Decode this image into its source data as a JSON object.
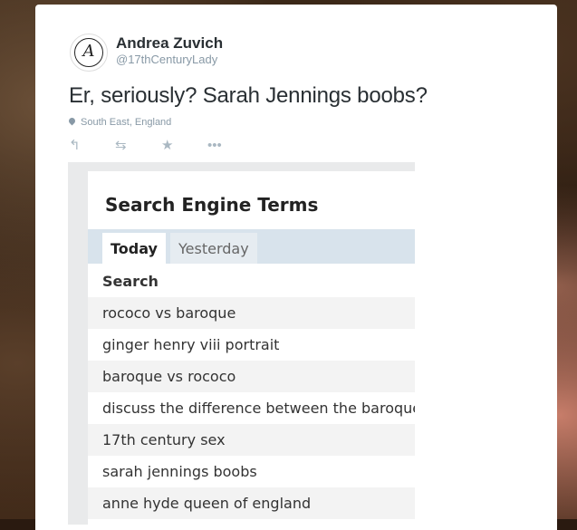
{
  "tweet": {
    "display_name": "Andrea Zuvich",
    "handle": "@17thCenturyLady",
    "text": "Er, seriously? Sarah Jennings boobs?",
    "location": "South East, England",
    "avatar_icon": "seventeenth-century-lady-monogram-icon",
    "actions": [
      {
        "name": "reply-icon",
        "glyph": "↰"
      },
      {
        "name": "retweet-icon",
        "glyph": "⇆"
      },
      {
        "name": "favorite-icon",
        "glyph": "★"
      },
      {
        "name": "more-icon",
        "glyph": "•••"
      }
    ]
  },
  "embedded_screenshot": {
    "title": "Search Engine Terms",
    "tabs": [
      {
        "label": "Today",
        "active": true
      },
      {
        "label": "Yesterday",
        "active": false
      }
    ],
    "column_header": "Search",
    "rows": [
      "rococo vs baroque",
      "ginger henry viii portrait",
      "baroque vs rococo",
      "discuss the difference between the baroque",
      "17th century sex",
      "sarah jennings boobs",
      "anne hyde queen of england"
    ]
  },
  "colors": {
    "name": "#292f33",
    "muted": "#8899a6",
    "tab_bar": "#d8e3ec",
    "row_alt": "#f3f3f3"
  }
}
